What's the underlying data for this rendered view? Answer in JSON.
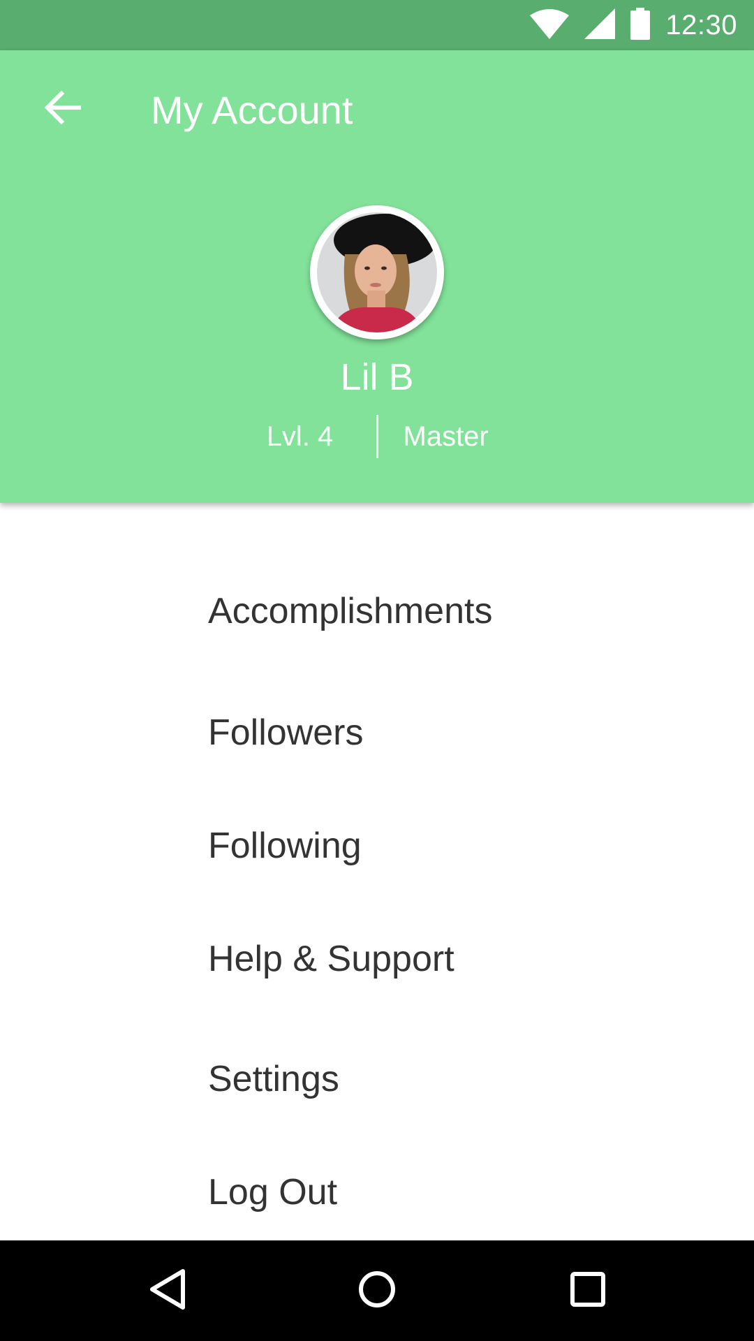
{
  "status_bar": {
    "time": "12:30",
    "icons": [
      "wifi-icon",
      "cellular-signal-icon",
      "battery-icon"
    ]
  },
  "header": {
    "title": "My Account",
    "back_icon": "arrow-left-icon"
  },
  "profile": {
    "name": "Lil B",
    "level": "Lvl. 4",
    "rank": "Master"
  },
  "menu": {
    "items": [
      {
        "label": "Accomplishments"
      },
      {
        "label": "Followers"
      },
      {
        "label": "Following"
      },
      {
        "label": "Help & Support"
      },
      {
        "label": "Settings"
      },
      {
        "label": "Log Out"
      }
    ]
  },
  "nav_bar": {
    "icons": [
      "back-triangle-icon",
      "home-circle-icon",
      "recents-square-icon"
    ]
  },
  "colors": {
    "status_bar": "#59ad6e",
    "header": "#82e29a",
    "menu_text": "#333333",
    "nav_bar": "#000000"
  }
}
